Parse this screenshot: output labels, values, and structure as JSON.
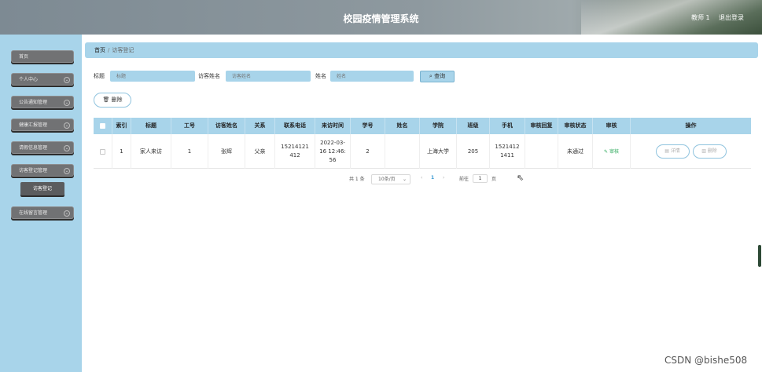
{
  "header": {
    "title": "校园疫情管理系统",
    "user": "教师 1",
    "logout": "退出登录"
  },
  "sidebar": {
    "items": [
      {
        "label": "首页"
      },
      {
        "label": "个人中心"
      },
      {
        "label": "公告通知管理"
      },
      {
        "label": "健康汇报管理"
      },
      {
        "label": "请假信息管理"
      },
      {
        "label": "访客登记管理"
      },
      {
        "label": "在线留言管理"
      }
    ],
    "active_sub": "访客登记"
  },
  "breadcrumb": {
    "home": "首页",
    "current": "访客登记"
  },
  "search": {
    "title_label": "标题",
    "title_placeholder": "标题",
    "visitor_label": "访客姓名",
    "visitor_placeholder": "访客姓名",
    "name_label": "姓名",
    "name_placeholder": "姓名",
    "query_label": "查询"
  },
  "actions": {
    "delete_label": "删除"
  },
  "table": {
    "headers": [
      "索引",
      "标题",
      "工号",
      "访客姓名",
      "关系",
      "联系电话",
      "来访时间",
      "学号",
      "姓名",
      "学院",
      "班级",
      "手机",
      "审核回复",
      "审核状态",
      "审核",
      "操作"
    ],
    "rows": [
      {
        "index": "1",
        "title": "家人来访",
        "staff_no": "1",
        "visitor": "张辉",
        "relation": "父亲",
        "phone": "15214121412",
        "visit_time": "2022-03-16 12:46:56",
        "student_no": "2",
        "name": "",
        "college": "上海大学",
        "class": "205",
        "mobile": "15214121411",
        "reply": "",
        "status": "未通过",
        "audit": "审核",
        "detail_btn": "详情",
        "delete_btn": "删除"
      }
    ]
  },
  "pagination": {
    "total": "共 1 条",
    "page_size": "10条/页",
    "current_page": "1",
    "goto_label": "前往",
    "goto_value": "1",
    "page_suffix": "页"
  },
  "watermark": "CSDN @bishe508"
}
